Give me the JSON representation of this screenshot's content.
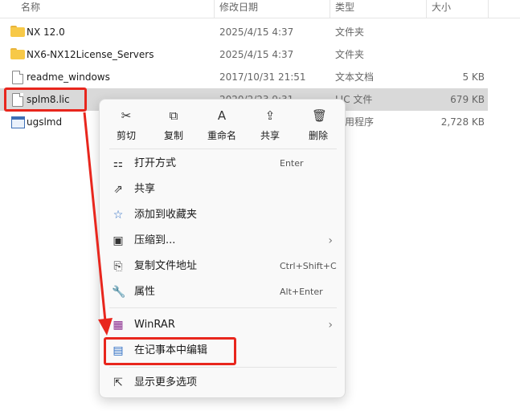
{
  "columns": {
    "name": "名称",
    "date": "修改日期",
    "type": "类型",
    "size": "大小"
  },
  "files": [
    {
      "name": "NX 12.0",
      "date": "2025/4/15 4:37",
      "type": "文件夹",
      "size": "",
      "icon": "folder-icon"
    },
    {
      "name": "NX6-NX12License_Servers",
      "date": "2025/4/15 4:37",
      "type": "文件夹",
      "size": "",
      "icon": "folder-icon"
    },
    {
      "name": "readme_windows",
      "date": "2017/10/31 21:51",
      "type": "文本文档",
      "size": "5 KB",
      "icon": "text-file-icon"
    },
    {
      "name": "splm8.lic",
      "date": "2020/2/23 9:31",
      "type": "LIC 文件",
      "size": "679 KB",
      "icon": "file-icon"
    },
    {
      "name": "ugslmd",
      "date": "",
      "type": "应用程序",
      "size": "2,728 KB",
      "icon": "application-icon"
    }
  ],
  "context_menu": {
    "toolbar": [
      {
        "label": "剪切",
        "icon": "cut-icon"
      },
      {
        "label": "复制",
        "icon": "copy-icon"
      },
      {
        "label": "重命名",
        "icon": "rename-icon"
      },
      {
        "label": "共享",
        "icon": "share-icon"
      },
      {
        "label": "删除",
        "icon": "delete-icon"
      }
    ],
    "items": [
      {
        "label": "打开方式",
        "shortcut": "Enter",
        "icon": "open-with-icon"
      },
      {
        "label": "共享",
        "shortcut": "",
        "icon": "share-icon"
      },
      {
        "label": "添加到收藏夹",
        "shortcut": "",
        "icon": "star-icon"
      },
      {
        "label": "压缩到...",
        "shortcut": "",
        "icon": "compress-icon",
        "submenu": true
      },
      {
        "label": "复制文件地址",
        "shortcut": "Ctrl+Shift+C",
        "icon": "copy-path-icon"
      },
      {
        "label": "属性",
        "shortcut": "Alt+Enter",
        "icon": "properties-icon"
      },
      {
        "label": "WinRAR",
        "shortcut": "",
        "icon": "winrar-icon",
        "submenu": true
      },
      {
        "label": "在记事本中编辑",
        "shortcut": "",
        "icon": "notepad-icon"
      },
      {
        "label": "显示更多选项",
        "shortcut": "",
        "icon": "more-options-icon"
      }
    ],
    "chevron": "›"
  },
  "glyphs": {
    "cut": "✂",
    "copy": "⧉",
    "rename": "A",
    "share": "⇪",
    "delete": "🗑",
    "open_with": "⚏",
    "share_item": "⇗",
    "star": "☆",
    "compress": "▣",
    "copy_path": "⎘",
    "properties": "🔧",
    "winrar": "▦",
    "notepad": "▤",
    "more": "⇱"
  },
  "colors": {
    "highlight": "#e8261d",
    "selection": "#d9d9d9",
    "folder": "#f7c948",
    "accent": "#3d6fb6"
  }
}
